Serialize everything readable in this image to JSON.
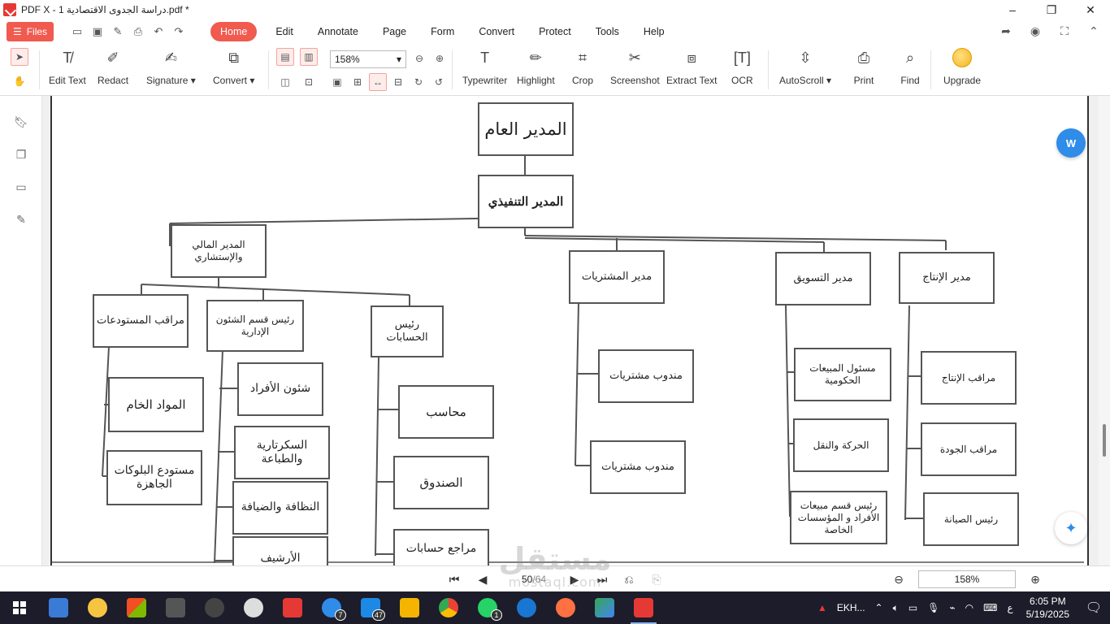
{
  "window": {
    "title": "PDF X - 1 دراسة الجدوى الاقتصادية.pdf *",
    "controls": {
      "minimize": "–",
      "maximize": "❐",
      "close": "✕"
    }
  },
  "menubar": {
    "files_label": "Files",
    "tabs": [
      "Home",
      "Edit",
      "Annotate",
      "Page",
      "Form",
      "Convert",
      "Protect",
      "Tools",
      "Help"
    ],
    "active_tab": "Home"
  },
  "ribbon": {
    "edit_text": "Edit Text",
    "redact": "Redact",
    "signature": "Signature ▾",
    "convert": "Convert ▾",
    "zoom_value": "158%",
    "typewriter": "Typewriter",
    "highlight": "Highlight",
    "crop": "Crop",
    "screenshot": "Screenshot",
    "extract_text": "Extract Text",
    "ocr": "OCR",
    "autoscroll": "AutoScroll ▾",
    "print": "Print",
    "find": "Find",
    "upgrade": "Upgrade"
  },
  "org_chart": {
    "general_manager": "المدير العام",
    "executive_manager": "المدير التنفيذي",
    "finance": "المدير المالي والإستشاري",
    "purchasing": "مدير المشتريات",
    "marketing": "مدير التسويق",
    "production": "مدير الإنتاج",
    "warehouse_supervisor": "مراقب المستودعات",
    "admin_head": "رئيس قسم الشئون الإدارية",
    "accounts_head": "رئيس الحسابات",
    "raw_materials": "المواد الخام",
    "blocks_store": "مستودع البلوكات الجاهزة",
    "personnel": "شئون الأفراد",
    "secretarial": "السكرتارية والطباعة",
    "cleaning": "النظافة والضيافة",
    "archive": "الأرشيف",
    "accountant": "محاسب",
    "cashbox": "الصندوق",
    "auditor": "مراجع حسابات",
    "purchase_rep_1": "مندوب مشتريات",
    "purchase_rep_2": "مندوب مشتريات",
    "gov_sales": "مسئول المبيعات الحكومية",
    "movement": "الحركة والنقل",
    "private_sales": "رئيس قسم مبيعات الأفراد و المؤسسات الخاصة",
    "production_supervisor": "مراقب الإنتاج",
    "quality_supervisor": "مراقب الجودة",
    "maintenance_head": "رئيس الصيانة"
  },
  "navigation": {
    "current_page": "50",
    "total_pages": "/64",
    "zoom": "158%"
  },
  "watermark": {
    "arabic": "مستقل",
    "latin": "mostaql.com"
  },
  "taskbar": {
    "badges": {
      "messenger": "7",
      "todo": "47",
      "whatsapp": "1"
    },
    "tray_text": "EKH...",
    "tray_lang": "ع",
    "time": "6:05 PM",
    "date": "5/19/2025"
  },
  "colors": {
    "accent": "#f05a4f",
    "taskbar": "#1c1c2a",
    "float_button": "#2f8ce8"
  }
}
